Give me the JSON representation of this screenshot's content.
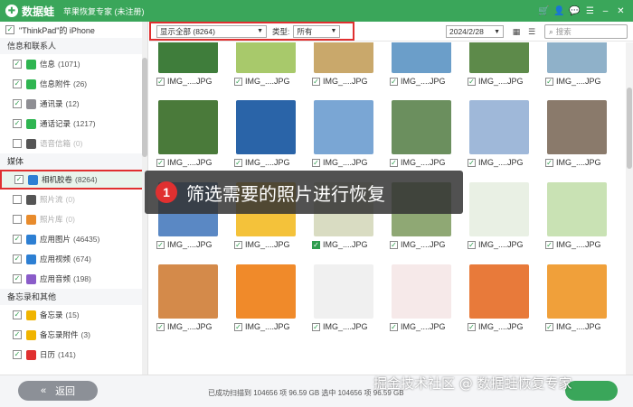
{
  "titlebar": {
    "logo_text": "数据蛙",
    "app_title": "苹果恢复专家 (未注册)",
    "icons": [
      "cart-icon",
      "user-icon",
      "chat-icon",
      "menu-icon",
      "minimize-icon",
      "close-icon"
    ]
  },
  "sidebar": {
    "device": "\"ThinkPad\"的 iPhone",
    "sections": [
      {
        "title": "信息和联系人",
        "items": [
          {
            "label": "信息",
            "count": "(1071)",
            "checked": true,
            "icon": "message-icon",
            "color": "#2fb551"
          },
          {
            "label": "信息附件",
            "count": "(26)",
            "checked": true,
            "icon": "message-attachment-icon",
            "color": "#2fb551"
          },
          {
            "label": "通讯录",
            "count": "(12)",
            "checked": true,
            "icon": "contacts-icon",
            "color": "#8e8e93"
          },
          {
            "label": "通话记录",
            "count": "(1217)",
            "checked": true,
            "icon": "phone-icon",
            "color": "#2fb551"
          },
          {
            "label": "语音信箱",
            "count": "(0)",
            "checked": false,
            "disabled": true,
            "icon": "voicemail-icon",
            "color": "#555555"
          }
        ]
      },
      {
        "title": "媒体",
        "items": [
          {
            "label": "相机胶卷",
            "count": "(8264)",
            "checked": true,
            "selected": true,
            "icon": "camera-roll-icon",
            "color": "#2d7fd3"
          },
          {
            "label": "照片流",
            "count": "(0)",
            "checked": false,
            "disabled": true,
            "icon": "photo-stream-icon",
            "color": "#555555"
          },
          {
            "label": "照片库",
            "count": "(0)",
            "checked": false,
            "disabled": true,
            "icon": "photo-library-icon",
            "color": "#e88b2c"
          },
          {
            "label": "应用图片",
            "count": "(46435)",
            "checked": true,
            "icon": "app-photos-icon",
            "color": "#2d7fd3"
          },
          {
            "label": "应用视频",
            "count": "(674)",
            "checked": true,
            "icon": "app-videos-icon",
            "color": "#2d7fd3"
          },
          {
            "label": "应用音频",
            "count": "(198)",
            "checked": true,
            "icon": "app-audio-icon",
            "color": "#8a5cc9"
          }
        ]
      },
      {
        "title": "备忘录和其他",
        "items": [
          {
            "label": "备忘录",
            "count": "(15)",
            "checked": true,
            "icon": "notes-icon",
            "color": "#f0b400"
          },
          {
            "label": "备忘录附件",
            "count": "(3)",
            "checked": true,
            "icon": "notes-attachment-icon",
            "color": "#f0b400"
          },
          {
            "label": "日历",
            "count": "(141)",
            "checked": true,
            "icon": "calendar-icon",
            "color": "#e03030"
          }
        ]
      }
    ]
  },
  "toolbar": {
    "filter_value": "显示全部 (8264)",
    "type_label": "类型:",
    "type_value": "所有",
    "date_value": "2024/2/28",
    "search_placeholder": "搜索"
  },
  "grid": {
    "filename": "IMG_....JPG",
    "rows": [
      {
        "colors": [
          "#3f7d3b",
          "#a8c96b",
          "#c9a86b",
          "#6b9ec9",
          "#5d8a4a",
          "#8fb1c9"
        ],
        "checked": [
          true,
          true,
          true,
          true,
          true,
          true
        ]
      },
      {
        "colors": [
          "#4a7a3a",
          "#2a64a8",
          "#7aa6d4",
          "#6b8f5e",
          "#9fb8d9",
          "#8a7a6b"
        ],
        "checked": [
          true,
          true,
          true,
          true,
          true,
          true
        ]
      },
      {
        "colors": [
          "#5a88c4",
          "#f4c23a",
          "#d9dcc2",
          "#8fa874",
          "#e9f0e4",
          "#c9e2b4"
        ],
        "checked": [
          true,
          true,
          false,
          true,
          true,
          true
        ]
      },
      {
        "colors": [
          "#d48a4a",
          "#f08a2a",
          "#f0f0f0",
          "#f6e9e9",
          "#e87a3a",
          "#f0a03a"
        ],
        "checked": [
          true,
          true,
          true,
          true,
          true,
          true
        ]
      }
    ]
  },
  "callout": {
    "number": "1",
    "text": "筛选需要的照片进行恢复"
  },
  "bottombar": {
    "back_label": "返回",
    "status": "已成功扫描到 104656 项 96.59 GB   选中 104656 项 96.59 GB",
    "watermark": "掘金技术社区 @ 数据蛙恢复专家"
  }
}
